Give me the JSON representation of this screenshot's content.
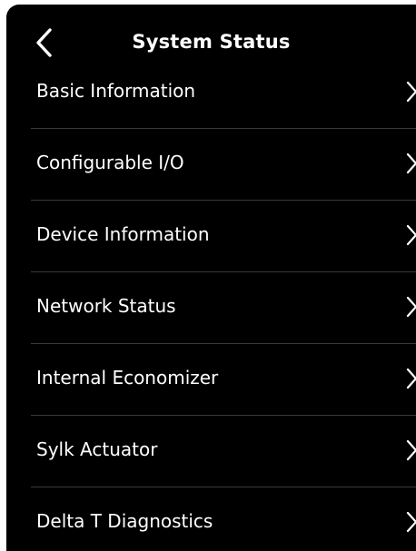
{
  "header": {
    "title": "System Status",
    "back_icon": "chevron-left-icon"
  },
  "menu": {
    "items": [
      {
        "label": "Basic Information",
        "icon": "chevron-right-icon"
      },
      {
        "label": "Configurable I/O",
        "icon": "chevron-right-icon"
      },
      {
        "label": "Device Information",
        "icon": "chevron-right-icon"
      },
      {
        "label": "Network Status",
        "icon": "chevron-right-icon"
      },
      {
        "label": "Internal Economizer",
        "icon": "chevron-right-icon"
      },
      {
        "label": "Sylk Actuator",
        "icon": "chevron-right-icon"
      },
      {
        "label": "Delta T Diagnostics",
        "icon": "chevron-right-icon"
      }
    ]
  },
  "colors": {
    "background": "#000000",
    "text": "#ffffff",
    "divider": "#3a3a3a"
  }
}
